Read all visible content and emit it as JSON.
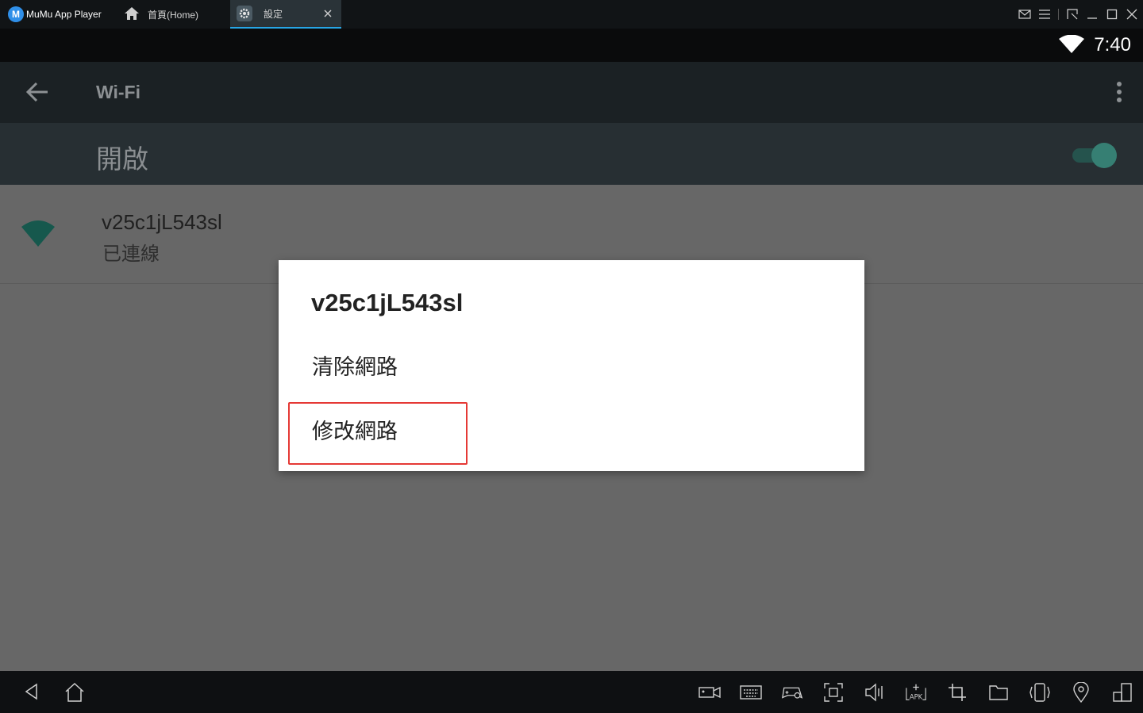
{
  "window": {
    "app_name": "MuMu App Player",
    "tabs": [
      {
        "label": "首頁(Home)"
      },
      {
        "label": "設定"
      }
    ]
  },
  "status_bar": {
    "time": "7:40"
  },
  "app_bar": {
    "title": "Wi-Fi"
  },
  "master_switch": {
    "label": "開啟",
    "state": "on"
  },
  "network": {
    "ssid": "v25c1jL543sl",
    "status": "已連線"
  },
  "dialog": {
    "title": "v25c1jL543sl",
    "items": [
      {
        "label": "清除網路"
      },
      {
        "label": "修改網路"
      }
    ]
  },
  "colors": {
    "accent_teal": "#367f73",
    "highlight_red": "#e53935",
    "tab_indicator": "#27a6e6"
  }
}
